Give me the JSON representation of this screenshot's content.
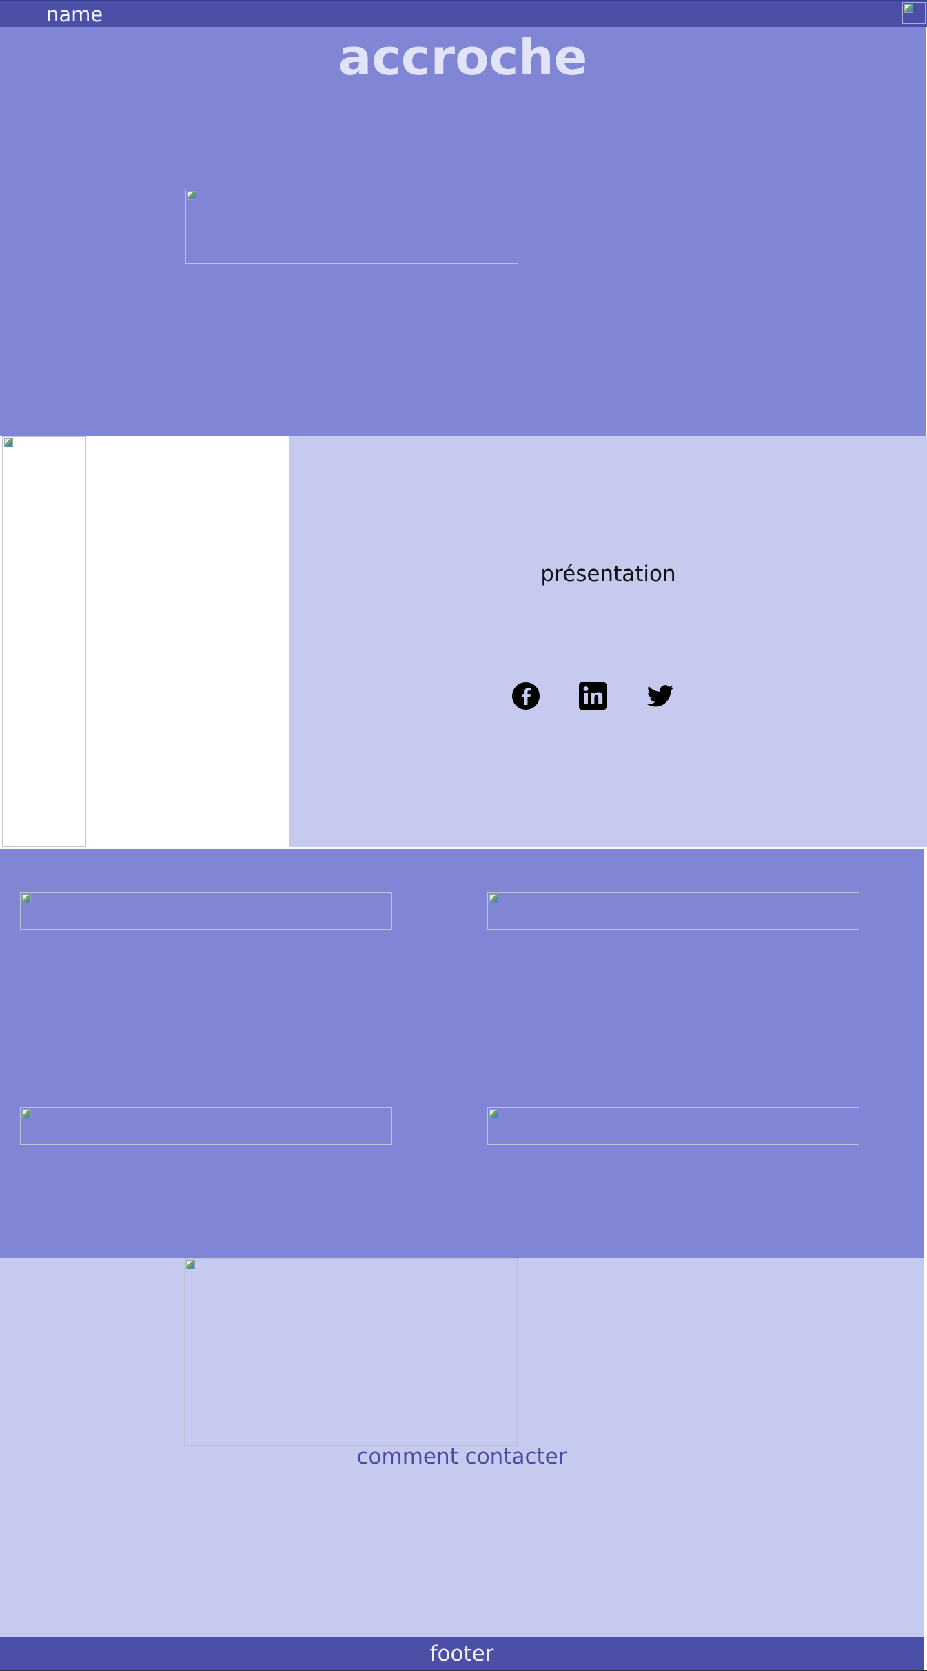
{
  "header": {
    "name": "name",
    "menu_icon": "broken-image-icon"
  },
  "hero": {
    "accroche": "accroche"
  },
  "presentation": {
    "title": "présentation",
    "social": [
      {
        "name": "facebook-icon"
      },
      {
        "name": "linkedin-icon"
      },
      {
        "name": "twitter-icon"
      }
    ]
  },
  "contact": {
    "label": "comment contacter"
  },
  "footer": {
    "text": "footer"
  },
  "colors": {
    "header_bg": "#4b4fa6",
    "hero_bg": "#8086d5",
    "light_bg": "#c7caef",
    "contact_text": "#474ca0"
  }
}
